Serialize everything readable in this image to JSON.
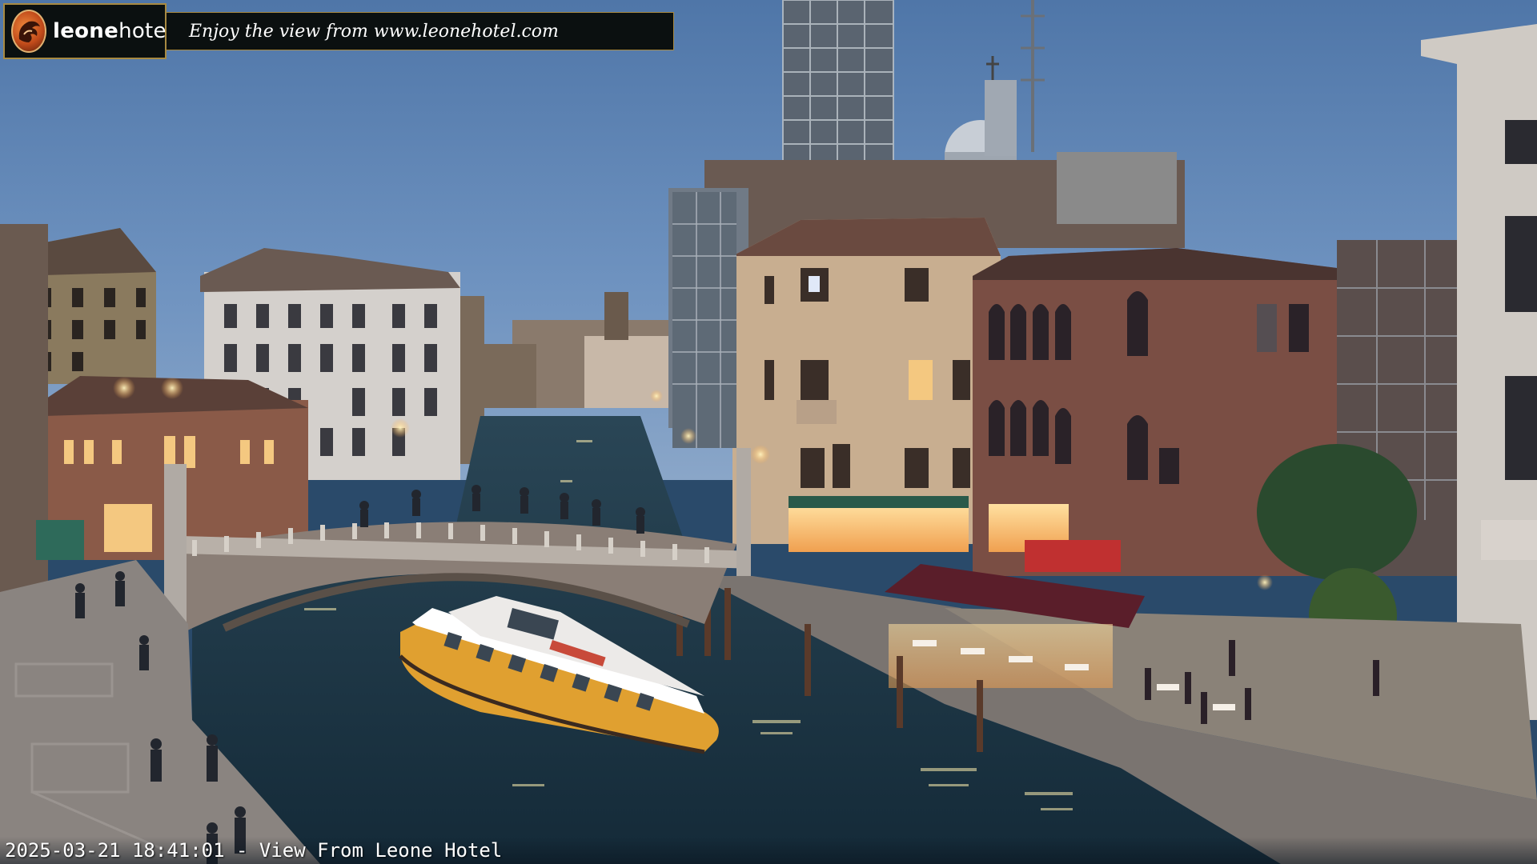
{
  "brand": {
    "name_bold": "leone",
    "name_regular": "hotel",
    "logo_icon": "lion-logo-icon",
    "accent_color": "#a88a42"
  },
  "tagline": "Enjoy the view from www.leonehotel.com",
  "overlay": {
    "timestamp": "2025-03-21 18:41:01 - View From Leone Hotel"
  },
  "scene": {
    "sky_color": "#5e84b4",
    "water_color": "#1e3c4e",
    "boat_color": "#e0a030"
  }
}
